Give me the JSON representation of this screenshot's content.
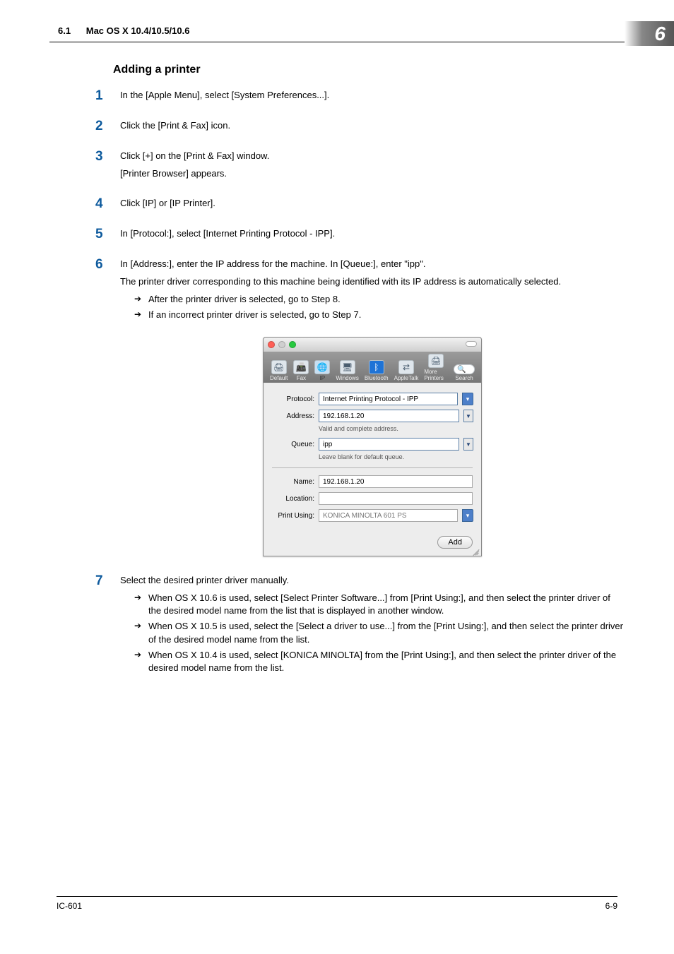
{
  "header": {
    "section_no": "6.1",
    "section_label": "Mac OS X 10.4/10.5/10.6",
    "chapter_no": "6"
  },
  "title": "Adding a printer",
  "steps": [
    {
      "num": "1",
      "lines": [
        "In the [Apple Menu], select [System Preferences...]."
      ]
    },
    {
      "num": "2",
      "lines": [
        "Click the [Print & Fax] icon."
      ]
    },
    {
      "num": "3",
      "lines": [
        "Click [+] on the [Print & Fax] window.",
        "[Printer Browser] appears."
      ]
    },
    {
      "num": "4",
      "lines": [
        "Click [IP] or [IP Printer]."
      ]
    },
    {
      "num": "5",
      "lines": [
        "In [Protocol:], select [Internet Printing Protocol - IPP]."
      ]
    },
    {
      "num": "6",
      "lines": [
        "In [Address:], enter the IP address for the machine. In [Queue:], enter \"ipp\".",
        "The printer driver corresponding to this machine being identified with its IP address is automatically selected."
      ],
      "arrows": [
        "After the printer driver is selected, go to Step 8.",
        "If an incorrect printer driver is selected, go to Step 7."
      ]
    },
    {
      "num": "7",
      "lines": [
        "Select the desired printer driver manually."
      ],
      "arrows": [
        "When OS X 10.6 is used, select [Select Printer Software...] from [Print Using:], and then select the printer driver of the desired model name from the list that is displayed in another window.",
        "When OS X 10.5 is used, select the [Select a driver to use...] from the [Print Using:], and then select the printer driver of the desired model name from the list.",
        "When OS X 10.4 is used, select [KONICA MINOLTA] from the [Print Using:], and then select the printer driver of the desired model name from the list."
      ]
    }
  ],
  "screenshot": {
    "toolbar": {
      "default": "Default",
      "fax": "Fax",
      "ip": "IP",
      "windows": "Windows",
      "bluetooth": "Bluetooth",
      "appletalk": "AppleTalk",
      "more": "More Printers",
      "search": "Search"
    },
    "labels": {
      "protocol": "Protocol:",
      "address": "Address:",
      "queue": "Queue:",
      "name": "Name:",
      "location": "Location:",
      "print_using": "Print Using:"
    },
    "values": {
      "protocol": "Internet Printing Protocol - IPP",
      "address": "192.168.1.20",
      "address_helper": "Valid and complete address.",
      "queue": "ipp",
      "queue_helper": "Leave blank for default queue.",
      "name": "192.168.1.20",
      "location": "",
      "print_using": "KONICA MINOLTA 601 PS"
    },
    "add_button": "Add"
  },
  "footer": {
    "left": "IC-601",
    "right": "6-9"
  }
}
